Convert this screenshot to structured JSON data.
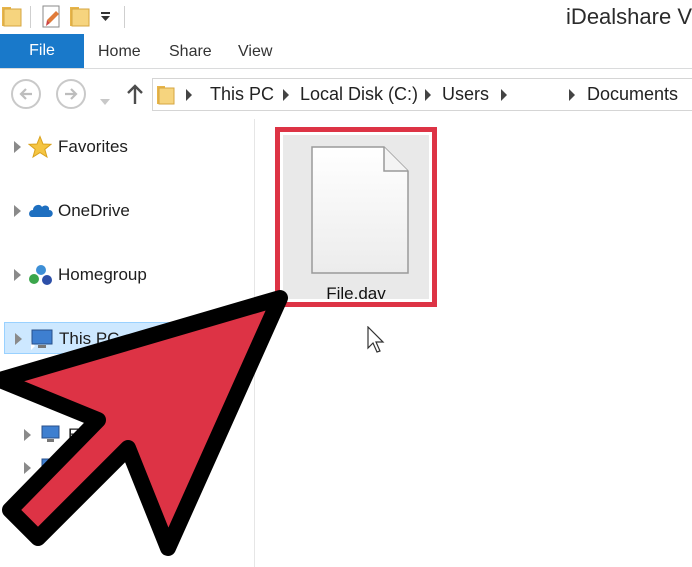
{
  "window": {
    "title": "iDealshare V"
  },
  "quick_access": {
    "icons": [
      "folder-icon",
      "properties-icon",
      "new-folder-icon",
      "customize-dropdown-icon"
    ]
  },
  "ribbon": {
    "tabs": [
      {
        "label": "File",
        "active": true
      },
      {
        "label": "Home"
      },
      {
        "label": "Share"
      },
      {
        "label": "View"
      }
    ]
  },
  "address_bar": {
    "crumbs": [
      "This PC",
      "Local Disk (C:)",
      "Users",
      "Documents"
    ]
  },
  "nav_pane": {
    "items": [
      {
        "label": "Favorites",
        "icon": "star-icon"
      },
      {
        "label": "OneDrive",
        "icon": "cloud-icon"
      },
      {
        "label": "Homegroup",
        "icon": "homegroup-icon"
      },
      {
        "label": "This PC",
        "icon": "computer-icon",
        "selected": true
      },
      {
        "label": "EP",
        "icon": "network-computer-icon"
      },
      {
        "label": "",
        "icon": "network-computer-icon"
      }
    ]
  },
  "content": {
    "files": [
      {
        "name": "File.dav",
        "icon": "blank-document-icon",
        "highlighted": true
      }
    ]
  },
  "colors": {
    "accent": "#1979ca",
    "highlight": "#dd3345",
    "selection": "#cde8ff"
  }
}
